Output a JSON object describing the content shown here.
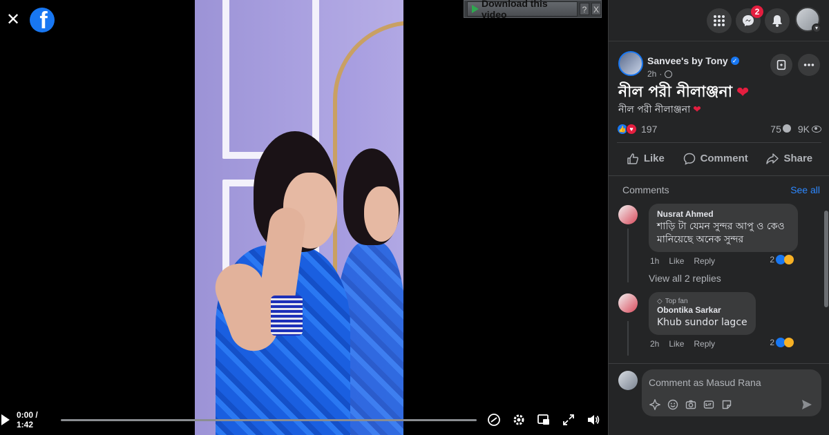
{
  "download_bar": {
    "label": "Download this video",
    "help": "?",
    "close": "X"
  },
  "player": {
    "time": "0:00 / 1:42",
    "progress_fraction": 0.0
  },
  "header": {
    "notifications_badge": "2"
  },
  "post": {
    "page_name": "Sanvee's by Tony",
    "time": "2h",
    "title": "নীল পরী নীলাঞ্জনা",
    "subtitle": "নীল পরী নীলাঞ্জনা",
    "reactions_count": "197",
    "comments_count": "75",
    "views_count": "9K"
  },
  "actions": {
    "like": "Like",
    "comment": "Comment",
    "share": "Share"
  },
  "comments_section": {
    "label": "Comments",
    "see_all": "See all",
    "items": [
      {
        "name": "Nusrat Ahmed",
        "text": "শাড়ি টা যেমন সুন্দর আপু ও কেও মানিয়েছে অনেক সুন্দর",
        "time": "1h",
        "like": "Like",
        "reply": "Reply",
        "reactions": "2",
        "view_replies": "View all 2 replies"
      },
      {
        "badge": "Top fan",
        "name": "Obontika Sarkar",
        "text": "Khub sundor lagce",
        "time": "2h",
        "like": "Like",
        "reply": "Reply",
        "reactions": "2"
      }
    ]
  },
  "composer": {
    "placeholder": "Comment as Masud Rana"
  },
  "colors": {
    "accent": "#1877f2",
    "panel_bg": "#242526",
    "bubble_bg": "#3a3b3c",
    "love": "#e41e3f",
    "link": "#2d88ff"
  }
}
